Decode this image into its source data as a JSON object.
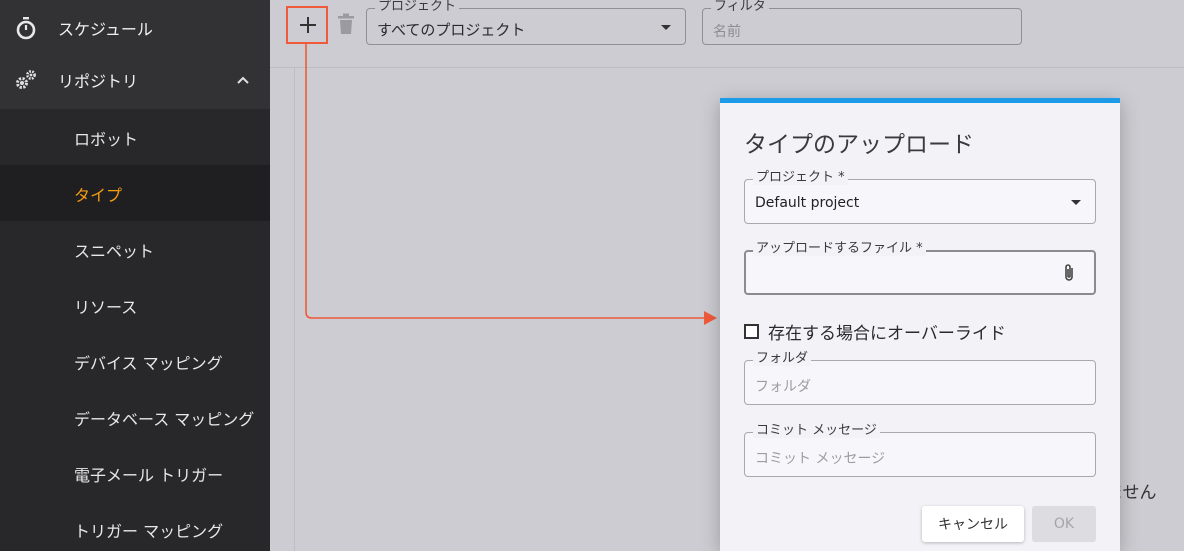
{
  "sidebar": {
    "top_items": [
      {
        "label": "スケジュール",
        "icon": "stopwatch-icon"
      },
      {
        "label": "リポジトリ",
        "icon": "gears-icon",
        "expanded": true
      }
    ],
    "sub_items": [
      {
        "label": "ロボット"
      },
      {
        "label": "タイプ",
        "active": true
      },
      {
        "label": "スニペット"
      },
      {
        "label": "リソース"
      },
      {
        "label": "デバイス マッピング"
      },
      {
        "label": "データベース マッピング"
      },
      {
        "label": "電子メール トリガー"
      },
      {
        "label": "トリガー マッピング"
      }
    ]
  },
  "toolbar": {
    "project_legend": "プロジェクト",
    "project_value": "すべてのプロジェクト",
    "filter_legend": "フィルタ",
    "filter_placeholder": "名前"
  },
  "background": {
    "partial_text": "ません"
  },
  "dialog": {
    "title": "タイプのアップロード",
    "project_legend": "プロジェクト *",
    "project_value": "Default project",
    "file_legend": "アップロードするファイル *",
    "override_label": "存在する場合にオーバーライド",
    "folder_legend": "フォルダ",
    "folder_placeholder": "フォルダ",
    "commit_legend": "コミット メッセージ",
    "commit_placeholder": "コミット メッセージ",
    "cancel_label": "キャンセル",
    "ok_label": "OK"
  },
  "colors": {
    "accent": "#f39c12",
    "annotation": "#ef5a3a",
    "dialog_top_bar": "#1e9be8",
    "sidebar_bg": "#323235"
  }
}
